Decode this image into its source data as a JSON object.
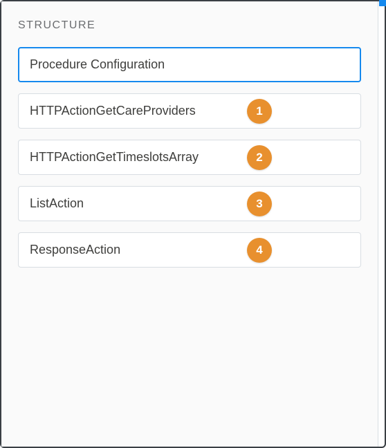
{
  "panel": {
    "title": "STRUCTURE",
    "items": [
      {
        "label": "Procedure Configuration",
        "selected": true
      },
      {
        "label": "HTTPActionGetCareProviders",
        "badge": "1"
      },
      {
        "label": "HTTPActionGetTimeslotsArray",
        "badge": "2"
      },
      {
        "label": "ListAction",
        "badge": "3"
      },
      {
        "label": "ResponseAction",
        "badge": "4"
      }
    ]
  },
  "colors": {
    "accent": "#1589ee",
    "badge": "#e8902e"
  }
}
